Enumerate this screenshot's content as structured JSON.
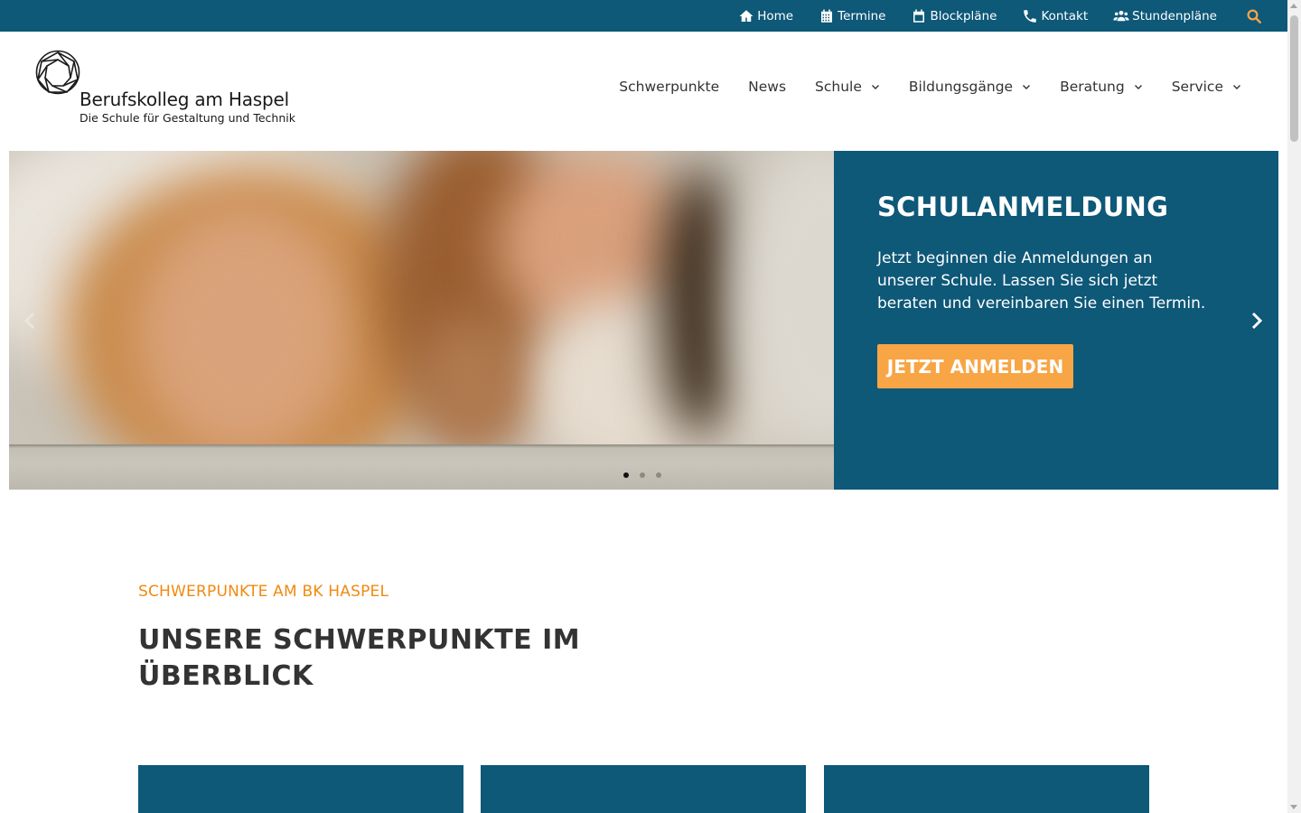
{
  "topbar": {
    "links": [
      {
        "label": "Home",
        "icon": "home-icon"
      },
      {
        "label": "Termine",
        "icon": "calendar-grid-icon"
      },
      {
        "label": "Blockpläne",
        "icon": "calendar-icon"
      },
      {
        "label": "Kontakt",
        "icon": "phone-icon"
      },
      {
        "label": "Stundenpläne",
        "icon": "users-icon"
      }
    ],
    "search_icon": "search-icon"
  },
  "logo": {
    "name": "Berufskolleg am Haspel",
    "tagline": "Die Schule für Gestaltung und Technik"
  },
  "main_nav": [
    {
      "label": "Schwerpunkte",
      "has_dropdown": false
    },
    {
      "label": "News",
      "has_dropdown": false
    },
    {
      "label": "Schule",
      "has_dropdown": true
    },
    {
      "label": "Bildungsgänge",
      "has_dropdown": true
    },
    {
      "label": "Beratung",
      "has_dropdown": true
    },
    {
      "label": "Service",
      "has_dropdown": true
    }
  ],
  "hero": {
    "title": "SCHULANMELDUNG",
    "text": "Jetzt beginnen die Anmeldungen an unserer Schule. Lassen Sie sich jetzt beraten und vereinbaren Sie einen Termin.",
    "button_label": "JETZT ANMELDEN",
    "slide_count": 3,
    "active_slide": 1
  },
  "section": {
    "kicker": "SCHWERPUNKTE AM BK HASPEL",
    "title": "UNSERE SCHWERPUNKTE IM ÜBERBLICK"
  },
  "colors": {
    "brand_blue": "#0e5878",
    "accent_orange": "#f7a545",
    "kicker_orange": "#f08a10"
  }
}
